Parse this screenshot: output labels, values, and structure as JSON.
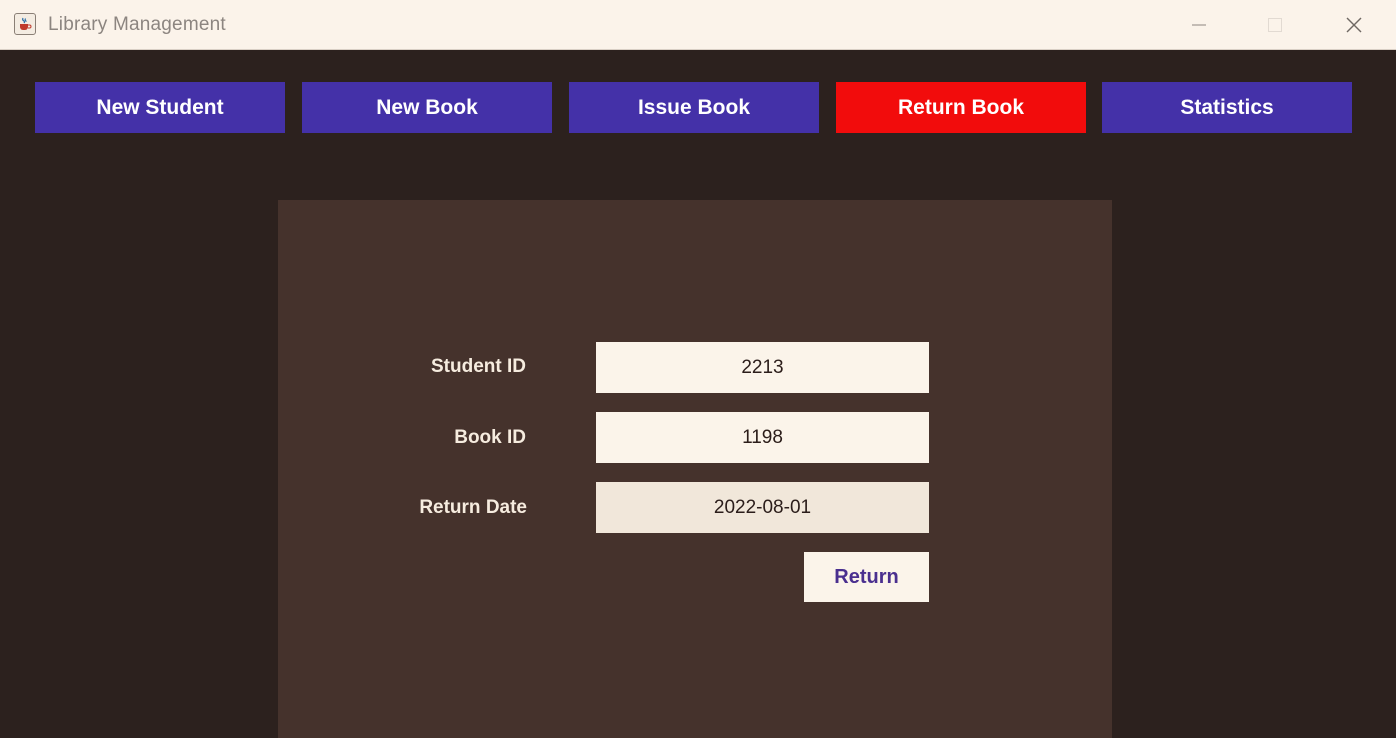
{
  "window": {
    "title": "Library Management",
    "app_icon": "java-cup-icon",
    "controls": [
      "minimize-icon",
      "maximize-icon",
      "close-icon"
    ]
  },
  "nav": {
    "items": [
      {
        "label": "New Student",
        "active": false
      },
      {
        "label": "New Book",
        "active": false
      },
      {
        "label": "Issue Book",
        "active": false
      },
      {
        "label": "Return Book",
        "active": true
      },
      {
        "label": "Statistics",
        "active": false
      }
    ]
  },
  "form": {
    "student_id_label": "Student ID",
    "student_id_value": "2213",
    "book_id_label": "Book ID",
    "book_id_value": "1198",
    "return_date_label": "Return Date",
    "return_date_value": "2022-08-01",
    "submit_label": "Return"
  },
  "colors": {
    "nav_default": "#4431a8",
    "nav_active": "#f20c0c",
    "background": "#2c211e",
    "panel": "#45322c",
    "field": "#fbf4ea",
    "submit_text": "#4a2f8f"
  }
}
